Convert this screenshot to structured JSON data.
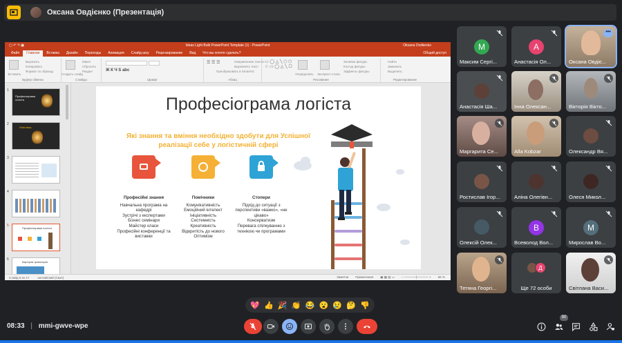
{
  "meeting": {
    "presenter_label": "Оксана Овдієнко (Презентація)",
    "time": "08:33",
    "separator": "|",
    "code": "mmi-gwve-wpe",
    "participants_badge": "90"
  },
  "ppt": {
    "window_title": "Ideas Light Bulb PowerPoint Template (1) - PowerPoint",
    "user_name": "Oksana Ovdiienko",
    "tabs": [
      "Файл",
      "Главная",
      "Вставка",
      "Дизайн",
      "Переходы",
      "Анимация",
      "Слайд-шоу",
      "Рецензирование",
      "Вид",
      "Что вы хотите сделать?"
    ],
    "share": "Общий доступ",
    "ribbon_groups": [
      "Буфер обмена",
      "Слайды",
      "Шрифт",
      "Абзац",
      "Рисование",
      "Редактирование"
    ],
    "ribbon_buttons": {
      "paste": "Вставить",
      "new_slide": "Создать слайд",
      "find": "Найти",
      "replace": "Заменить",
      "select": "Выделить",
      "cut": "Вырезать",
      "copy": "Копировать",
      "format": "Формат по образцу",
      "layout": "Макет",
      "reset": "Сбросить",
      "section": "Раздел",
      "arrange": "Упорядочить",
      "styles": "Экспресс-стили",
      "fill": "Заливка фигуры",
      "outline": "Контур фигуры",
      "effects": "Эффекты фигуры",
      "text_dir": "Направление текста",
      "align_text": "Выровнять текст",
      "smartart": "Преобразовать в SmartArt"
    },
    "status_left": "Слайд 5 из 17",
    "status_lang": "английский (США)",
    "status_notes": "Заметки",
    "status_comments": "Примечания",
    "zoom": "66 %"
  },
  "slide": {
    "title": "Професіограма логіста",
    "subtitle": "Які знання та вміння необхідно здобути для Успішної реалізації себе у логістичній сфері",
    "columns": [
      {
        "heading": "Професійні знання",
        "lines": [
          "Навчальна програма на кафедрі",
          "Зустрічі з експертами",
          "Бізнес семінари",
          "Майстер класи",
          "Професійні конференції та виставки"
        ],
        "color": "#e8553c"
      },
      {
        "heading": "Помічники",
        "lines": [
          "Комунікативність",
          "Емоційний інтелект",
          "Ініціативність",
          "Системність",
          "Креативність",
          "Відкритість до нового",
          "Оптимізм"
        ],
        "color": "#f5b035"
      },
      {
        "heading": "Стопери",
        "lines": [
          "Підхід до ситуації з перспективи «важко», «не цікаво»",
          "Консерватизм",
          "Перевага спілкуванню з технікою чи програмами"
        ],
        "color": "#2fa3d6"
      }
    ]
  },
  "thumbnails": [
    {
      "num": "1",
      "label": "Професіограма логіста"
    },
    {
      "num": "2",
      "label": "Логістика"
    },
    {
      "num": "3",
      "label": ""
    },
    {
      "num": "4",
      "label": ""
    },
    {
      "num": "5",
      "label": "Професіограма логіста"
    },
    {
      "num": "6",
      "label": "Кар'єрна траєкторія"
    }
  ],
  "participants": [
    {
      "name": "Максим Сергі...",
      "letter": "М",
      "color": "#33a852"
    },
    {
      "name": "Анастасія Ол...",
      "letter": "А",
      "color": "#e8436f"
    },
    {
      "name": "Оксана Овдіє...",
      "letter": "",
      "color": "#a1887f"
    },
    {
      "name": "Анастасія Ша...",
      "letter": "",
      "color": "#5d4037"
    },
    {
      "name": "Інна Олексан...",
      "letter": "",
      "color": "#8d6e63"
    },
    {
      "name": "Вікторія Вікто...",
      "letter": "",
      "color": "#9e9e9e"
    },
    {
      "name": "Маргарита Се...",
      "letter": "",
      "color": "#b0736b"
    },
    {
      "name": "Alla Kobzar",
      "letter": "",
      "color": "#c7a27a"
    },
    {
      "name": "Олександр Вя...",
      "letter": "",
      "color": "#6d4c41"
    },
    {
      "name": "Ростислав Ігор...",
      "letter": "",
      "color": "#795548"
    },
    {
      "name": "Аліна Олегівн...",
      "letter": "",
      "color": "#4e342e"
    },
    {
      "name": "Олеся Микол...",
      "letter": "",
      "color": "#3e2723"
    },
    {
      "name": "Олексій Олек...",
      "letter": "",
      "color": "#455a64"
    },
    {
      "name": "Всеволод Вол...",
      "letter": "В",
      "color": "#9334e6"
    },
    {
      "name": "Мирослав Во...",
      "letter": "М",
      "color": "#546e7a"
    },
    {
      "name": "Тетяна Георгі...",
      "letter": "",
      "color": "#c8a48a"
    },
    {
      "name": "Ще 72 особи",
      "letter": "",
      "color": "#3c4043"
    },
    {
      "name": "Світлана Васи...",
      "letter": "",
      "color": "#e0e0e0"
    }
  ],
  "reactions": [
    "💖",
    "👍",
    "🎉",
    "👏",
    "😂",
    "😮",
    "😢",
    "🤔",
    "👎"
  ],
  "colors": {
    "accent": "#8ab4f8",
    "end_call": "#ea4335",
    "ppt_red": "#c43e1c"
  }
}
